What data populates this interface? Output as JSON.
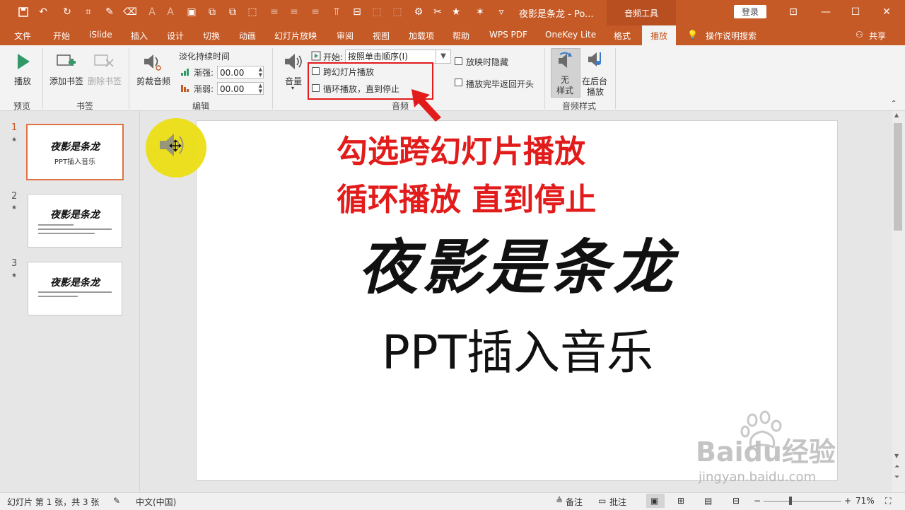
{
  "title_bar": {
    "doc_title": "夜影是条龙  -  Po...",
    "context_tab": "音频工具",
    "login_label": "登录",
    "window_controls": [
      "minimize-icon",
      "maximize-icon",
      "close-icon"
    ]
  },
  "tabs": {
    "items": [
      "文件",
      "开始",
      "iSlide",
      "插入",
      "设计",
      "切换",
      "动画",
      "幻灯片放映",
      "审阅",
      "视图",
      "加载项",
      "帮助",
      "WPS PDF",
      "OneKey Lite",
      "格式"
    ],
    "active": "播放",
    "tell_me": "操作说明搜索",
    "share": "共享"
  },
  "ribbon": {
    "preview": {
      "play_label": "播放",
      "group": "预览"
    },
    "bookmarks": {
      "add_label": "添加书签",
      "remove_label": "删除书签",
      "group": "书签"
    },
    "editing": {
      "trim_label": "剪裁音频",
      "fade_title": "淡化持续时间",
      "fade_in_label": "渐强:",
      "fade_in_value": "00.00",
      "fade_out_label": "渐弱:",
      "fade_out_value": "00.00",
      "group": "编辑"
    },
    "audio_options": {
      "volume_label": "音量",
      "start_label": "开始:",
      "start_value": "按照单击顺序(I)",
      "play_across_slides": "跨幻灯片播放",
      "loop_until_stopped": "循环播放，直到停止",
      "hide_during_show": "放映时隐藏",
      "rewind_after_playing": "播放完毕返回开头",
      "group": "音频"
    },
    "audio_styles": {
      "no_style_label": [
        "无",
        "样式"
      ],
      "background_label": [
        "在后台",
        "播放"
      ],
      "group": "音频样式"
    }
  },
  "slides_panel": {
    "slides": [
      {
        "number": "1",
        "title": "夜影是条龙",
        "subtitle": "PPT插入音乐"
      },
      {
        "number": "2",
        "title": "夜影是条龙"
      },
      {
        "number": "3",
        "title": "夜影是条龙"
      }
    ]
  },
  "slide": {
    "title": "夜影是条龙",
    "subtitle": "PPT插入音乐"
  },
  "annotation": {
    "line1": "勾选跨幻灯片播放",
    "line2": "循环播放 直到停止"
  },
  "watermark": {
    "brand": "Baidu经验",
    "url": "jingyan.baidu.com"
  },
  "status_bar": {
    "slide_info": "幻灯片 第 1 张，共 3 张",
    "language": "中文(中国)",
    "notes_label": "备注",
    "comments_label": "批注",
    "zoom": "71%"
  },
  "colors": {
    "accent": "#c55a26",
    "highlight_red": "#e21b1b",
    "selection": "#e07246"
  }
}
